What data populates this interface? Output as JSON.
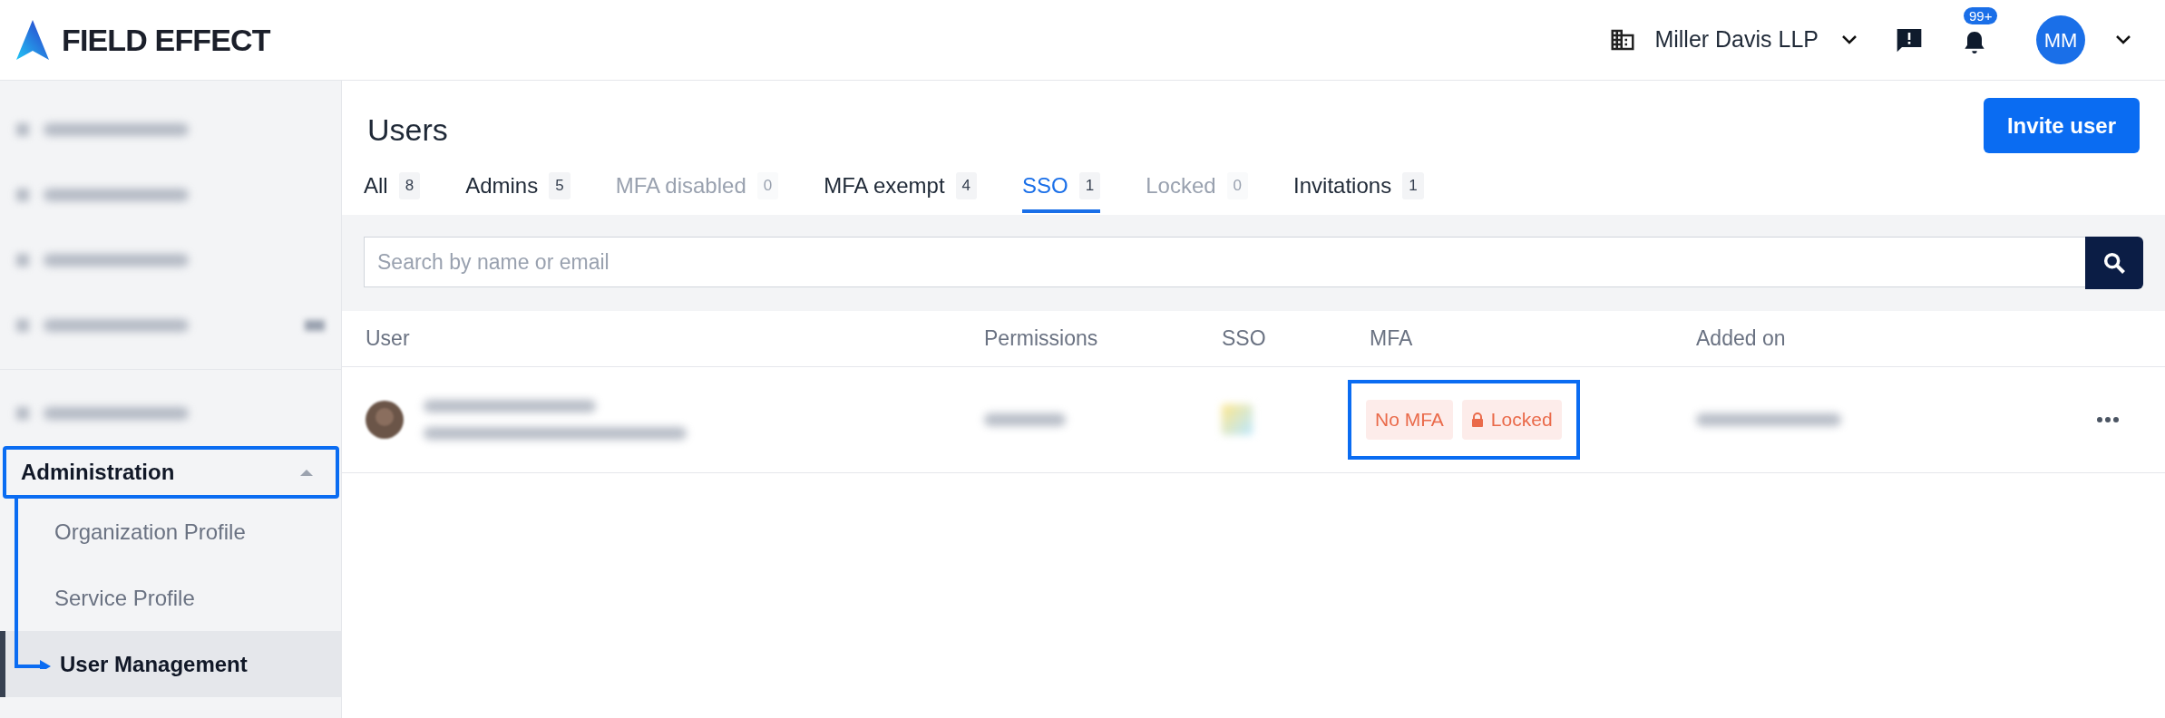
{
  "header": {
    "brand": "FIELD EFFECT",
    "organization": "Miller Davis LLP",
    "notification_count": "99+",
    "avatar_initials": "MM"
  },
  "sidebar": {
    "items": [
      {
        "kind": "blurred",
        "has_caret": false
      },
      {
        "kind": "blurred",
        "has_caret": false
      },
      {
        "kind": "blurred",
        "has_caret": false
      },
      {
        "kind": "blurred",
        "has_caret": true
      },
      {
        "kind": "divider"
      },
      {
        "kind": "blurred",
        "has_caret": false
      }
    ],
    "section": {
      "label": "Administration",
      "expanded": true,
      "highlighted": true,
      "children": [
        {
          "label": "Organization Profile",
          "selected": false
        },
        {
          "label": "Service Profile",
          "selected": false
        },
        {
          "label": "User Management",
          "selected": true
        }
      ]
    }
  },
  "page": {
    "title": "Users",
    "invite_button": "Invite user"
  },
  "tabs": [
    {
      "label": "All",
      "count": "8",
      "selected": false,
      "disabled": false
    },
    {
      "label": "Admins",
      "count": "5",
      "selected": false,
      "disabled": false
    },
    {
      "label": "MFA disabled",
      "count": "0",
      "selected": false,
      "disabled": true
    },
    {
      "label": "MFA exempt",
      "count": "4",
      "selected": false,
      "disabled": false
    },
    {
      "label": "SSO",
      "count": "1",
      "selected": true,
      "disabled": false
    },
    {
      "label": "Locked",
      "count": "0",
      "selected": false,
      "disabled": true
    },
    {
      "label": "Invitations",
      "count": "1",
      "selected": false,
      "disabled": false
    }
  ],
  "search": {
    "placeholder": "Search by name or email"
  },
  "table": {
    "columns": [
      "User",
      "Permissions",
      "SSO",
      "MFA",
      "Added on"
    ],
    "rows": [
      {
        "blurred": true,
        "mfa_badges": [
          {
            "label": "No MFA",
            "kind": "plain"
          },
          {
            "label": "Locked",
            "kind": "lock"
          }
        ],
        "mfa_highlighted": true
      }
    ]
  }
}
